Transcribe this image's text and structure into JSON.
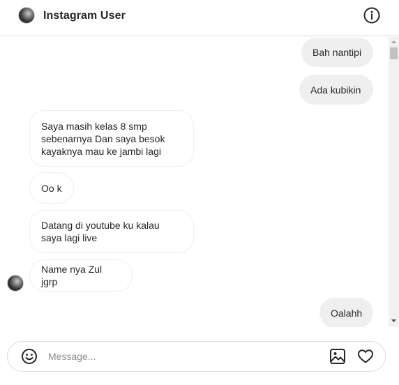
{
  "header": {
    "title": "Instagram User",
    "avatar_icon": "profile-avatar",
    "info_icon": "info-icon"
  },
  "messages": [
    {
      "direction": "sent",
      "text": "Bah nantipi"
    },
    {
      "direction": "sent",
      "text": "Ada kubikin"
    },
    {
      "direction": "received",
      "text": "Saya masih kelas 8 smp sebenarnya Dan saya besok kayaknya mau ke jambi lagi"
    },
    {
      "direction": "received",
      "text": "Oo k"
    },
    {
      "direction": "received",
      "text": "Datang di youtube ku kalau saya lagi live"
    },
    {
      "direction": "received",
      "text": "Name nya Zul jgrp"
    },
    {
      "direction": "sent",
      "text": "Oalahh"
    }
  ],
  "composer": {
    "placeholder": "Message...",
    "value": "",
    "emoji_icon": "emoji-icon",
    "gallery_icon": "image-icon",
    "like_icon": "heart-icon"
  },
  "colors": {
    "sent_bubble": "#efefef",
    "received_border": "#efefef",
    "divider": "#dbdbdb",
    "text": "#262626",
    "placeholder": "#8e8e8e"
  }
}
